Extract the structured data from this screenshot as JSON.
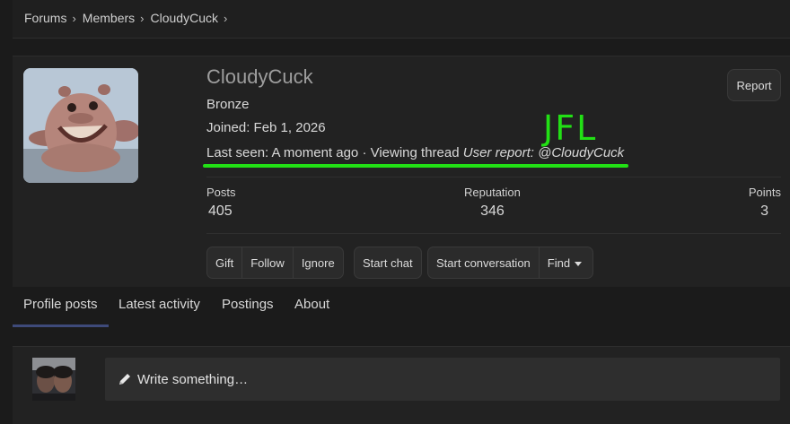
{
  "breadcrumb": {
    "items": [
      "Forums",
      "Members",
      "CloudyCuck"
    ],
    "sep": "›"
  },
  "profile": {
    "username": "CloudyCuck",
    "rank": "Bronze",
    "joined": "Joined: Feb 1, 2026",
    "last_seen_prefix": "Last seen: A moment ago · Viewing thread ",
    "last_seen_thread": "User report: @CloudyCuck",
    "annotation": "JFL",
    "annotation_color": "#22e015",
    "report_label": "Report"
  },
  "stats": [
    {
      "label": "Posts",
      "value": "405"
    },
    {
      "label": "Reputation",
      "value": "346"
    },
    {
      "label": "Points",
      "value": "3"
    }
  ],
  "actions": {
    "gift": "Gift",
    "follow": "Follow",
    "ignore": "Ignore",
    "start_chat": "Start chat",
    "start_conversation": "Start conversation",
    "find": "Find"
  },
  "tabs": [
    "Profile posts",
    "Latest activity",
    "Postings",
    "About"
  ],
  "composer": {
    "placeholder": "Write something…",
    "icon": "pencil-icon"
  }
}
